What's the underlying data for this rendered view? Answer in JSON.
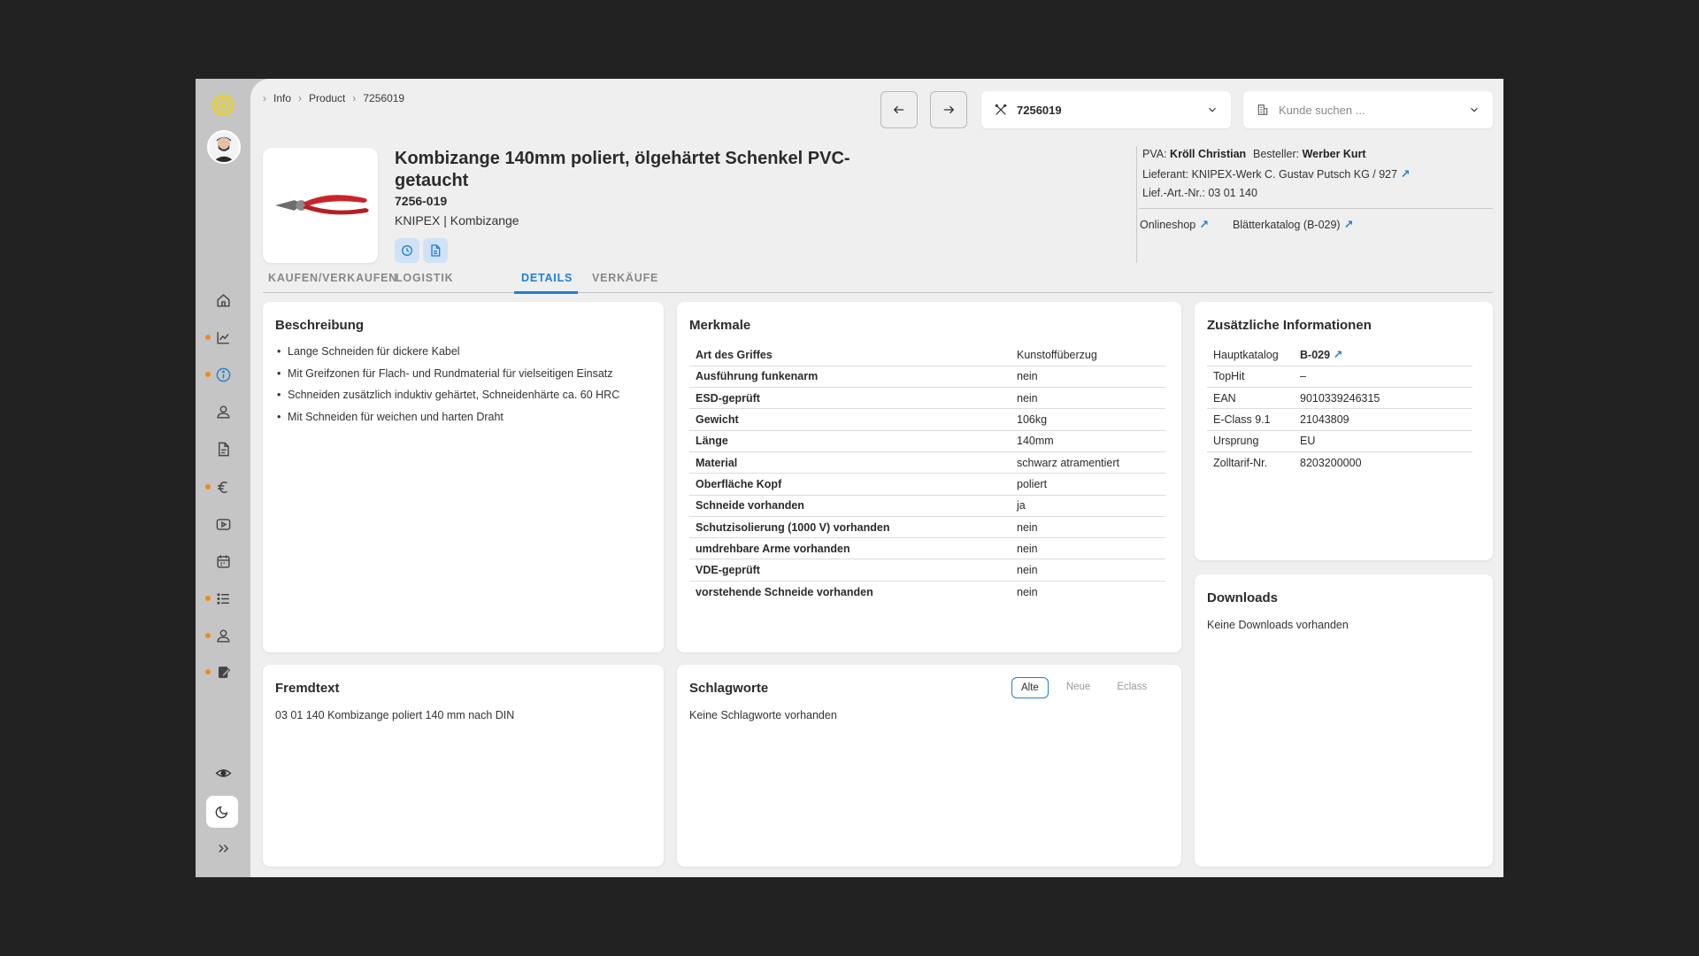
{
  "breadcrumb": [
    "Info",
    "Product",
    "7256019"
  ],
  "product_select": {
    "value": "7256019"
  },
  "customer_search": {
    "placeholder": "Kunde suchen ..."
  },
  "product": {
    "title": "Kombizange 140mm poliert, ölgehärtet Schenkel PVC-getaucht",
    "sku": "7256-019",
    "brand_line": "KNIPEX | Kombizange"
  },
  "meta": {
    "pva_label": "PVA:",
    "pva_value": "Kröll Christian",
    "besteller_label": "Besteller:",
    "besteller_value": "Werber Kurt",
    "lieferant": "Lieferant: KNIPEX-Werk C. Gustav Putsch KG / 927",
    "lief_art_nr": "Lief.-Art.-Nr.: 03 01 140",
    "link_onlineshop": "Onlineshop",
    "link_katalog": "Blätterkatalog (B-029)"
  },
  "tabs": [
    {
      "label": "KAUFEN/VERKAUFEN"
    },
    {
      "label": "LOGISTIK"
    },
    {
      "label": "DETAILS"
    },
    {
      "label": "VERKÄUFE"
    }
  ],
  "beschreibung": {
    "title": "Beschreibung",
    "items": [
      "Lange Schneiden für dickere Kabel",
      "Mit Greifzonen für Flach- und Rundmaterial für vielseitigen Einsatz",
      "Schneiden zusätzlich induktiv gehärtet, Schneidenhärte ca. 60 HRC",
      "Mit Schneiden für weichen und harten Draht"
    ]
  },
  "merkmale": {
    "title": "Merkmale",
    "rows": [
      {
        "k": "Art des Griffes",
        "v": "Kunstoffüberzug"
      },
      {
        "k": "Ausführung funkenarm",
        "v": "nein"
      },
      {
        "k": "ESD-geprüft",
        "v": "nein"
      },
      {
        "k": "Gewicht",
        "v": "106kg"
      },
      {
        "k": "Länge",
        "v": "140mm"
      },
      {
        "k": "Material",
        "v": "schwarz atramentiert"
      },
      {
        "k": "Oberfläche Kopf",
        "v": "poliert"
      },
      {
        "k": "Schneide vorhanden",
        "v": "ja"
      },
      {
        "k": "Schutzisolierung (1000 V) vorhanden",
        "v": "nein"
      },
      {
        "k": "umdrehbare Arme vorhanden",
        "v": "nein"
      },
      {
        "k": "VDE-geprüft",
        "v": "nein"
      },
      {
        "k": "vorstehende Schneide vorhanden",
        "v": "nein"
      }
    ]
  },
  "zusatz": {
    "title": "Zusätzliche Informationen",
    "rows": [
      {
        "k": "Hauptkatalog",
        "v": "B-029"
      },
      {
        "k": "TopHit",
        "v": "–"
      },
      {
        "k": "EAN",
        "v": "9010339246315"
      },
      {
        "k": "E-Class 9.1",
        "v": "21043809"
      },
      {
        "k": "Ursprung",
        "v": "EU"
      },
      {
        "k": "Zolltarif-Nr.",
        "v": "8203200000"
      }
    ]
  },
  "downloads": {
    "title": "Downloads",
    "empty": "Keine Downloads vorhanden"
  },
  "fremdtext": {
    "title": "Fremdtext",
    "text": "03 01 140 Kombizange poliert 140 mm nach DIN"
  },
  "schlagworte": {
    "title": "Schlagworte",
    "empty": "Keine Schlagworte vorhanden",
    "filters": [
      "Alte",
      "Neue",
      "Eclass"
    ]
  },
  "colors": {
    "accent": "#1e7fd6",
    "notify_dot": "#f08a1c"
  }
}
